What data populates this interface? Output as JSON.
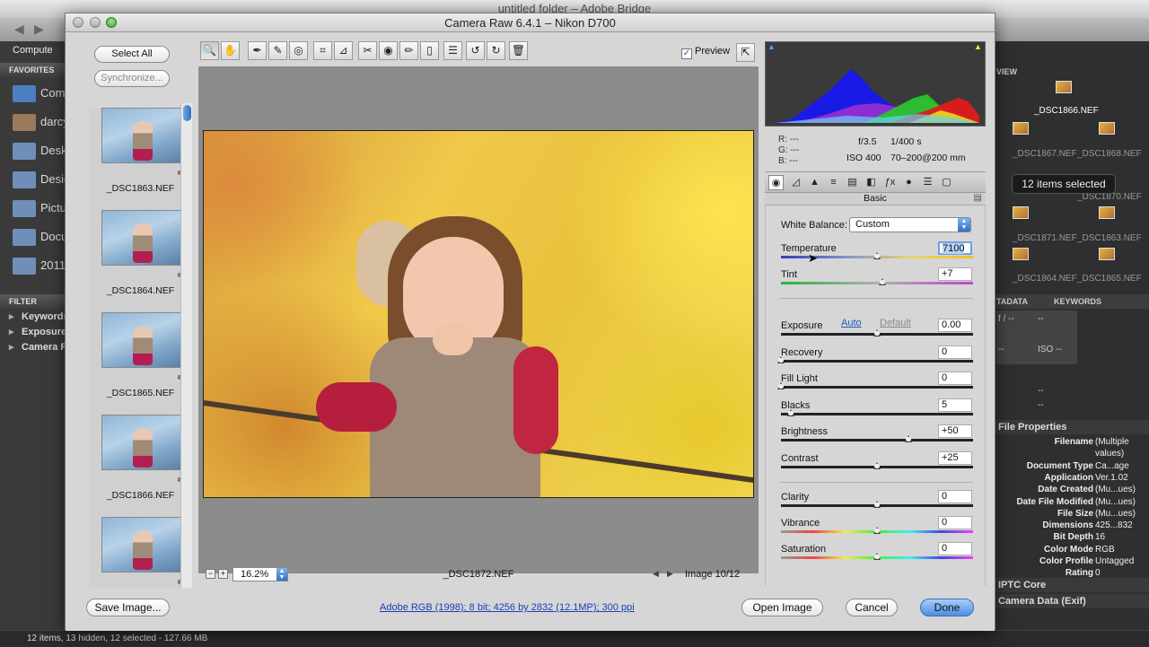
{
  "bridge": {
    "window_title": "untitled folder – Adobe Bridge",
    "path_item": "Compute",
    "favorites_header": "FAVORITES",
    "favorites": [
      "Com",
      "darcy",
      "Desk",
      "Desig",
      "Pictu",
      "Docu",
      "2011"
    ],
    "filter_header": "FILTER",
    "filters": [
      "Keywords",
      "Exposure",
      "Camera R"
    ],
    "review_tab": "VIEW",
    "files_right": {
      "visible_name": "_DSC1866.NEF",
      "row_labels": [
        "_DSC1867.NEF",
        "_DSC1868.NEF",
        "_DSC1870.NEF",
        "_DSC1871.NEF",
        "_DSC1863.NEF",
        "_DSC1864.NEF",
        "_DSC1865.NEF"
      ]
    },
    "tooltip": "12 items selected",
    "metadata_tabs": [
      "TADATA",
      "KEYWORDS"
    ],
    "metadata_values": [
      "f / --",
      "--",
      "--",
      "ISO --",
      "--",
      "--"
    ],
    "file_properties_header": "File Properties",
    "file_properties": [
      {
        "key": "Filename",
        "value": "(Multiple"
      },
      {
        "key": "",
        "value": "values)"
      },
      {
        "key": "Document Type",
        "value": "Ca...age"
      },
      {
        "key": "Application",
        "value": "Ver.1.02"
      },
      {
        "key": "Date Created",
        "value": "(Mu...ues)"
      },
      {
        "key": "Date File Modified",
        "value": "(Mu...ues)"
      },
      {
        "key": "File Size",
        "value": "(Mu...ues)"
      },
      {
        "key": "Dimensions",
        "value": "425...832"
      },
      {
        "key": "Bit Depth",
        "value": "16"
      },
      {
        "key": "Color Mode",
        "value": "RGB"
      },
      {
        "key": "Color Profile",
        "value": "Untagged"
      },
      {
        "key": "Rating",
        "value": "0"
      }
    ],
    "iptc_header": "IPTC Core",
    "camera_data_header": "Camera Data (Exif)",
    "status_text": "12 items, 13 hidden, 12 selected - 127.66 MB"
  },
  "dialog": {
    "title": "Camera Raw 6.4.1  –  Nikon D700",
    "select_all": "Select All",
    "synchronize": "Synchronize...",
    "thumbnails": [
      "_DSC1863.NEF",
      "_DSC1864.NEF",
      "_DSC1865.NEF",
      "_DSC1866.NEF",
      ""
    ],
    "preview_label": "Preview",
    "tools": [
      "zoom-icon",
      "hand-icon",
      "white-balance-icon",
      "color-sampler-icon",
      "target-adjust-icon",
      "crop-icon",
      "straighten-icon",
      "spot-removal-icon",
      "red-eye-icon",
      "adjustment-brush-icon",
      "graduated-filter-icon",
      "preferences-icon",
      "rotate-ccw-icon",
      "rotate-cw-icon",
      "trash-icon"
    ],
    "zoom_level": "16.2%",
    "current_file": "_DSC1872.NEF",
    "image_count": "Image 10/12",
    "readout": {
      "r": "R:",
      "g": "G:",
      "b": "B:",
      "r_val": "---",
      "g_val": "---",
      "b_val": "---"
    },
    "exposure_info": {
      "aperture": "f/3.5",
      "shutter": "1/400 s",
      "iso": "ISO 400",
      "lens": "70–200@200 mm"
    },
    "panel_name": "Basic",
    "white_balance_label": "White Balance:",
    "white_balance_value": "Custom",
    "auto_label": "Auto",
    "default_label": "Default",
    "sliders": {
      "temperature": {
        "label": "Temperature",
        "value": "7100",
        "fraction": 0.5
      },
      "tint": {
        "label": "Tint",
        "value": "+7",
        "fraction": 0.53
      },
      "exposure": {
        "label": "Exposure",
        "value": "0.00",
        "fraction": 0.5
      },
      "recovery": {
        "label": "Recovery",
        "value": "0",
        "fraction": 0.0
      },
      "fill_light": {
        "label": "Fill Light",
        "value": "0",
        "fraction": 0.0
      },
      "blacks": {
        "label": "Blacks",
        "value": "5",
        "fraction": 0.05
      },
      "brightness": {
        "label": "Brightness",
        "value": "+50",
        "fraction": 0.665
      },
      "contrast": {
        "label": "Contrast",
        "value": "+25",
        "fraction": 0.5
      },
      "clarity": {
        "label": "Clarity",
        "value": "0",
        "fraction": 0.5
      },
      "vibrance": {
        "label": "Vibrance",
        "value": "0",
        "fraction": 0.5
      },
      "saturation": {
        "label": "Saturation",
        "value": "0",
        "fraction": 0.5
      }
    },
    "save_image": "Save Image...",
    "workflow": "Adobe RGB (1998); 8 bit; 4256 by 2832 (12.1MP); 300 ppi",
    "open_image": "Open Image",
    "cancel": "Cancel",
    "done": "Done"
  }
}
